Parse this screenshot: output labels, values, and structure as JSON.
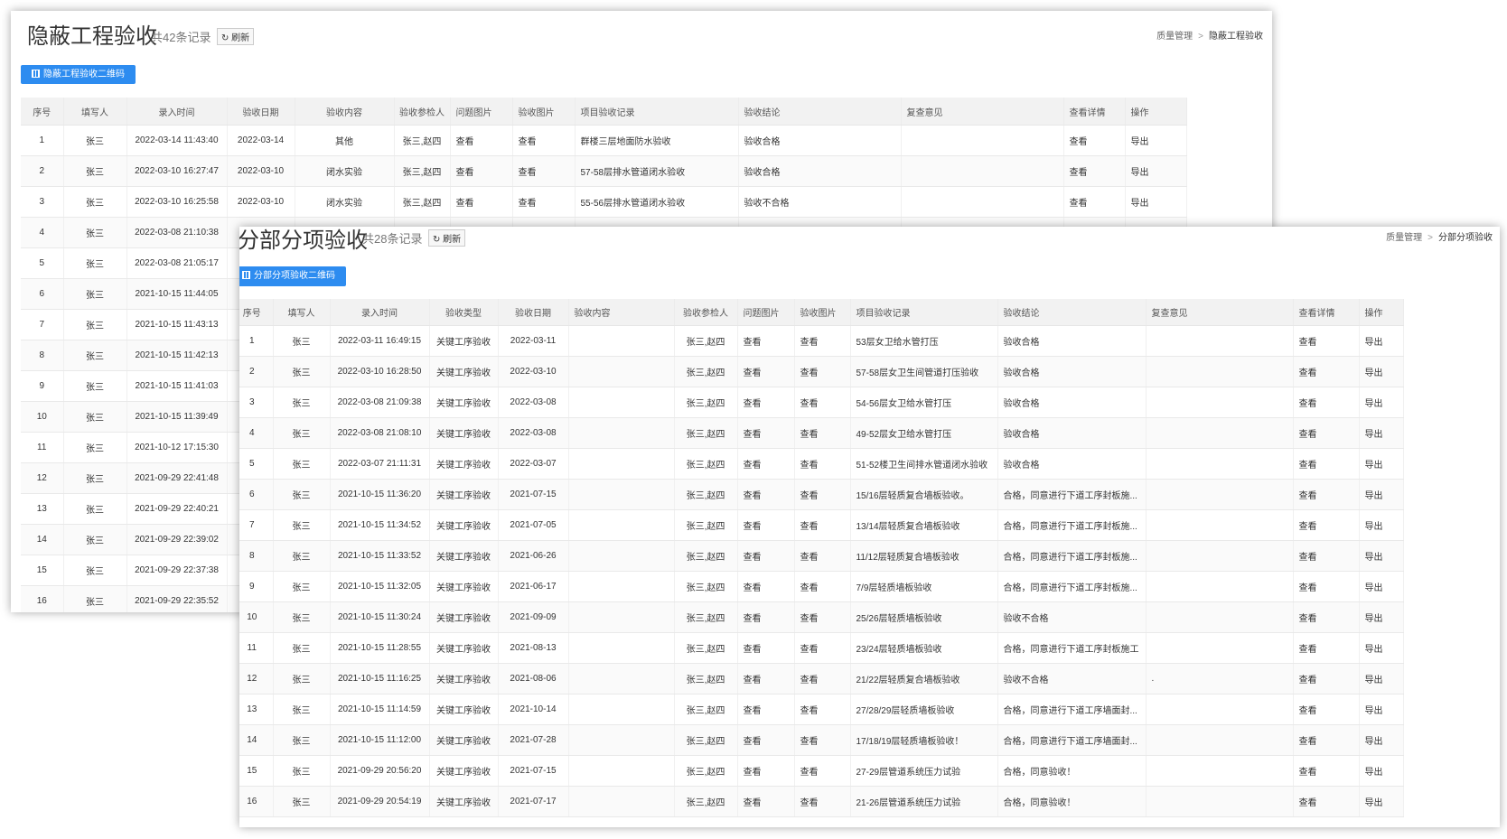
{
  "colors": {
    "accent": "#2d8cf0",
    "fail": "#e02020",
    "header_bg": "#f2f2f2"
  },
  "panel1": {
    "title": "隐蔽工程验收",
    "count": "共42条记录",
    "refresh_label": "刷新",
    "qr_label": "隐蔽工程验收二维码",
    "breadcrumb": {
      "parent": "质量管理",
      "separator": ">",
      "current": "隐蔽工程验收"
    },
    "columns": [
      "序号",
      "填写人",
      "录入时间",
      "验收日期",
      "验收内容",
      "验收参检人",
      "问题图片",
      "验收图片",
      "项目验收记录",
      "验收结论",
      "复查意见",
      "查看详情",
      "操作"
    ],
    "rows": [
      {
        "no": "1",
        "writer": "张三",
        "entry_time": "2022-03-14 11:43:40",
        "date": "2022-03-14",
        "content": "其他",
        "people": "张三,赵四",
        "issue_img": "查看",
        "accept_img": "查看",
        "record": "群楼三层地面防水验收",
        "conclusion": "验收合格",
        "fail": false,
        "review": "",
        "detail": "查看",
        "action": "导出"
      },
      {
        "no": "2",
        "writer": "张三",
        "entry_time": "2022-03-10 16:27:47",
        "date": "2022-03-10",
        "content": "闭水实验",
        "people": "张三,赵四",
        "issue_img": "查看",
        "accept_img": "查看",
        "record": "57-58层排水管道闭水验收",
        "conclusion": "验收合格",
        "fail": false,
        "review": "",
        "detail": "查看",
        "action": "导出"
      },
      {
        "no": "3",
        "writer": "张三",
        "entry_time": "2022-03-10 16:25:58",
        "date": "2022-03-10",
        "content": "闭水实验",
        "people": "张三,赵四",
        "issue_img": "查看",
        "accept_img": "查看",
        "record": "55-56层排水管道闭水验收",
        "conclusion": "验收不合格",
        "fail": true,
        "review": "",
        "detail": "查看",
        "action": "导出"
      },
      {
        "no": "4",
        "writer": "张三",
        "entry_time": "2022-03-08 21:10:38",
        "date": "",
        "content": "",
        "people": "",
        "issue_img": "",
        "accept_img": "",
        "record": "",
        "conclusion": "",
        "fail": false,
        "review": "",
        "detail": "",
        "action": ""
      },
      {
        "no": "5",
        "writer": "张三",
        "entry_time": "2022-03-08 21:05:17",
        "date": "",
        "content": "",
        "people": "",
        "issue_img": "",
        "accept_img": "",
        "record": "",
        "conclusion": "",
        "fail": false,
        "review": "",
        "detail": "",
        "action": ""
      },
      {
        "no": "6",
        "writer": "张三",
        "entry_time": "2021-10-15 11:44:05",
        "date": "",
        "content": "",
        "people": "",
        "issue_img": "",
        "accept_img": "",
        "record": "",
        "conclusion": "",
        "fail": false,
        "review": "",
        "detail": "",
        "action": ""
      },
      {
        "no": "7",
        "writer": "张三",
        "entry_time": "2021-10-15 11:43:13",
        "date": "",
        "content": "",
        "people": "",
        "issue_img": "",
        "accept_img": "",
        "record": "",
        "conclusion": "",
        "fail": false,
        "review": "",
        "detail": "",
        "action": ""
      },
      {
        "no": "8",
        "writer": "张三",
        "entry_time": "2021-10-15 11:42:13",
        "date": "",
        "content": "",
        "people": "",
        "issue_img": "",
        "accept_img": "",
        "record": "",
        "conclusion": "",
        "fail": false,
        "review": "",
        "detail": "",
        "action": ""
      },
      {
        "no": "9",
        "writer": "张三",
        "entry_time": "2021-10-15 11:41:03",
        "date": "",
        "content": "",
        "people": "",
        "issue_img": "",
        "accept_img": "",
        "record": "",
        "conclusion": "",
        "fail": false,
        "review": "",
        "detail": "",
        "action": ""
      },
      {
        "no": "10",
        "writer": "张三",
        "entry_time": "2021-10-15 11:39:49",
        "date": "",
        "content": "",
        "people": "",
        "issue_img": "",
        "accept_img": "",
        "record": "",
        "conclusion": "",
        "fail": false,
        "review": "",
        "detail": "",
        "action": ""
      },
      {
        "no": "11",
        "writer": "张三",
        "entry_time": "2021-10-12 17:15:30",
        "date": "",
        "content": "",
        "people": "",
        "issue_img": "",
        "accept_img": "",
        "record": "",
        "conclusion": "",
        "fail": false,
        "review": "",
        "detail": "",
        "action": ""
      },
      {
        "no": "12",
        "writer": "张三",
        "entry_time": "2021-09-29 22:41:48",
        "date": "",
        "content": "",
        "people": "",
        "issue_img": "",
        "accept_img": "",
        "record": "",
        "conclusion": "",
        "fail": false,
        "review": "",
        "detail": "",
        "action": ""
      },
      {
        "no": "13",
        "writer": "张三",
        "entry_time": "2021-09-29 22:40:21",
        "date": "",
        "content": "",
        "people": "",
        "issue_img": "",
        "accept_img": "",
        "record": "",
        "conclusion": "",
        "fail": false,
        "review": "",
        "detail": "",
        "action": ""
      },
      {
        "no": "14",
        "writer": "张三",
        "entry_time": "2021-09-29 22:39:02",
        "date": "",
        "content": "",
        "people": "",
        "issue_img": "",
        "accept_img": "",
        "record": "",
        "conclusion": "",
        "fail": false,
        "review": "",
        "detail": "",
        "action": ""
      },
      {
        "no": "15",
        "writer": "张三",
        "entry_time": "2021-09-29 22:37:38",
        "date": "",
        "content": "",
        "people": "",
        "issue_img": "",
        "accept_img": "",
        "record": "",
        "conclusion": "",
        "fail": false,
        "review": "",
        "detail": "",
        "action": ""
      },
      {
        "no": "16",
        "writer": "张三",
        "entry_time": "2021-09-29 22:35:52",
        "date": "",
        "content": "",
        "people": "",
        "issue_img": "",
        "accept_img": "",
        "record": "",
        "conclusion": "",
        "fail": false,
        "review": "",
        "detail": "",
        "action": ""
      }
    ]
  },
  "panel2": {
    "title": "分部分项验收",
    "count": "共28条记录",
    "refresh_label": "刷新",
    "qr_label": "分部分项验收二维码",
    "breadcrumb": {
      "parent": "质量管理",
      "separator": ">",
      "current": "分部分项验收"
    },
    "columns": [
      "序号",
      "填写人",
      "录入时间",
      "验收类型",
      "验收日期",
      "验收内容",
      "验收参检人",
      "问题图片",
      "验收图片",
      "项目验收记录",
      "验收结论",
      "复查意见",
      "查看详情",
      "操作"
    ],
    "rows": [
      {
        "no": "1",
        "writer": "张三",
        "entry_time": "2022-03-11 16:49:15",
        "type": "关键工序验收",
        "date": "2022-03-11",
        "content": "",
        "people": "张三,赵四",
        "issue_img": "查看",
        "accept_img": "查看",
        "record": "53层女卫给水管打压",
        "conclusion": "验收合格",
        "fail": false,
        "review": "",
        "detail": "查看",
        "action": "导出"
      },
      {
        "no": "2",
        "writer": "张三",
        "entry_time": "2022-03-10 16:28:50",
        "type": "关键工序验收",
        "date": "2022-03-10",
        "content": "",
        "people": "张三,赵四",
        "issue_img": "查看",
        "accept_img": "查看",
        "record": "57-58层女卫生间管道打压验收",
        "conclusion": "验收合格",
        "fail": false,
        "review": "",
        "detail": "查看",
        "action": "导出"
      },
      {
        "no": "3",
        "writer": "张三",
        "entry_time": "2022-03-08 21:09:38",
        "type": "关键工序验收",
        "date": "2022-03-08",
        "content": "",
        "people": "张三,赵四",
        "issue_img": "查看",
        "accept_img": "查看",
        "record": "54-56层女卫给水管打压",
        "conclusion": "验收合格",
        "fail": false,
        "review": "",
        "detail": "查看",
        "action": "导出"
      },
      {
        "no": "4",
        "writer": "张三",
        "entry_time": "2022-03-08 21:08:10",
        "type": "关键工序验收",
        "date": "2022-03-08",
        "content": "",
        "people": "张三,赵四",
        "issue_img": "查看",
        "accept_img": "查看",
        "record": "49-52层女卫给水管打压",
        "conclusion": "验收合格",
        "fail": false,
        "review": "",
        "detail": "查看",
        "action": "导出"
      },
      {
        "no": "5",
        "writer": "张三",
        "entry_time": "2022-03-07 21:11:31",
        "type": "关键工序验收",
        "date": "2022-03-07",
        "content": "",
        "people": "张三,赵四",
        "issue_img": "查看",
        "accept_img": "查看",
        "record": "51-52楼卫生间排水管道闭水验收",
        "conclusion": "验收合格",
        "fail": false,
        "review": "",
        "detail": "查看",
        "action": "导出"
      },
      {
        "no": "6",
        "writer": "张三",
        "entry_time": "2021-10-15 11:36:20",
        "type": "关键工序验收",
        "date": "2021-07-15",
        "content": "",
        "people": "张三,赵四",
        "issue_img": "查看",
        "accept_img": "查看",
        "record": "15/16层轻质复合墙板验收。",
        "conclusion": "合格，同意进行下道工序封板施...",
        "fail": false,
        "review": "",
        "detail": "查看",
        "action": "导出"
      },
      {
        "no": "7",
        "writer": "张三",
        "entry_time": "2021-10-15 11:34:52",
        "type": "关键工序验收",
        "date": "2021-07-05",
        "content": "",
        "people": "张三,赵四",
        "issue_img": "查看",
        "accept_img": "查看",
        "record": "13/14层轻质复合墙板验收",
        "conclusion": "合格，同意进行下道工序封板施...",
        "fail": false,
        "review": "",
        "detail": "查看",
        "action": "导出"
      },
      {
        "no": "8",
        "writer": "张三",
        "entry_time": "2021-10-15 11:33:52",
        "type": "关键工序验收",
        "date": "2021-06-26",
        "content": "",
        "people": "张三,赵四",
        "issue_img": "查看",
        "accept_img": "查看",
        "record": "11/12层轻质复合墙板验收",
        "conclusion": "合格，同意进行下道工序封板施...",
        "fail": false,
        "review": "",
        "detail": "查看",
        "action": "导出"
      },
      {
        "no": "9",
        "writer": "张三",
        "entry_time": "2021-10-15 11:32:05",
        "type": "关键工序验收",
        "date": "2021-06-17",
        "content": "",
        "people": "张三,赵四",
        "issue_img": "查看",
        "accept_img": "查看",
        "record": "7/9层轻质墙板验收",
        "conclusion": "合格，同意进行下道工序封板施...",
        "fail": false,
        "review": "",
        "detail": "查看",
        "action": "导出"
      },
      {
        "no": "10",
        "writer": "张三",
        "entry_time": "2021-10-15 11:30:24",
        "type": "关键工序验收",
        "date": "2021-09-09",
        "content": "",
        "people": "张三,赵四",
        "issue_img": "查看",
        "accept_img": "查看",
        "record": "25/26层轻质墙板验收",
        "conclusion": "验收不合格",
        "fail": true,
        "review": "",
        "detail": "查看",
        "action": "导出"
      },
      {
        "no": "11",
        "writer": "张三",
        "entry_time": "2021-10-15 11:28:55",
        "type": "关键工序验收",
        "date": "2021-08-13",
        "content": "",
        "people": "张三,赵四",
        "issue_img": "查看",
        "accept_img": "查看",
        "record": "23/24层轻质墙板验收",
        "conclusion": "合格，同意进行下道工序封板施工",
        "fail": false,
        "review": "",
        "detail": "查看",
        "action": "导出"
      },
      {
        "no": "12",
        "writer": "张三",
        "entry_time": "2021-10-15 11:16:25",
        "type": "关键工序验收",
        "date": "2021-08-06",
        "content": "",
        "people": "张三,赵四",
        "issue_img": "查看",
        "accept_img": "查看",
        "record": "21/22层轻质复合墙板验收",
        "conclusion": "验收不合格",
        "fail": true,
        "review": ".",
        "detail": "查看",
        "action": "导出"
      },
      {
        "no": "13",
        "writer": "张三",
        "entry_time": "2021-10-15 11:14:59",
        "type": "关键工序验收",
        "date": "2021-10-14",
        "content": "",
        "people": "张三,赵四",
        "issue_img": "查看",
        "accept_img": "查看",
        "record": "27/28/29层轻质墙板验收",
        "conclusion": "合格，同意进行下道工序墙面封...",
        "fail": false,
        "review": "",
        "detail": "查看",
        "action": "导出"
      },
      {
        "no": "14",
        "writer": "张三",
        "entry_time": "2021-10-15 11:12:00",
        "type": "关键工序验收",
        "date": "2021-07-28",
        "content": "",
        "people": "张三,赵四",
        "issue_img": "查看",
        "accept_img": "查看",
        "record": "17/18/19层轻质墙板验收！",
        "conclusion": "合格，同意进行下道工序墙面封...",
        "fail": false,
        "review": "",
        "detail": "查看",
        "action": "导出"
      },
      {
        "no": "15",
        "writer": "张三",
        "entry_time": "2021-09-29 20:56:20",
        "type": "关键工序验收",
        "date": "2021-07-15",
        "content": "",
        "people": "张三,赵四",
        "issue_img": "查看",
        "accept_img": "查看",
        "record": "27-29层管道系统压力试验",
        "conclusion": "合格，同意验收！",
        "fail": false,
        "review": "",
        "detail": "查看",
        "action": "导出"
      },
      {
        "no": "16",
        "writer": "张三",
        "entry_time": "2021-09-29 20:54:19",
        "type": "关键工序验收",
        "date": "2021-07-17",
        "content": "",
        "people": "张三,赵四",
        "issue_img": "查看",
        "accept_img": "查看",
        "record": "21-26层管道系统压力试验",
        "conclusion": "合格，同意验收！",
        "fail": false,
        "review": "",
        "detail": "查看",
        "action": "导出"
      }
    ]
  }
}
